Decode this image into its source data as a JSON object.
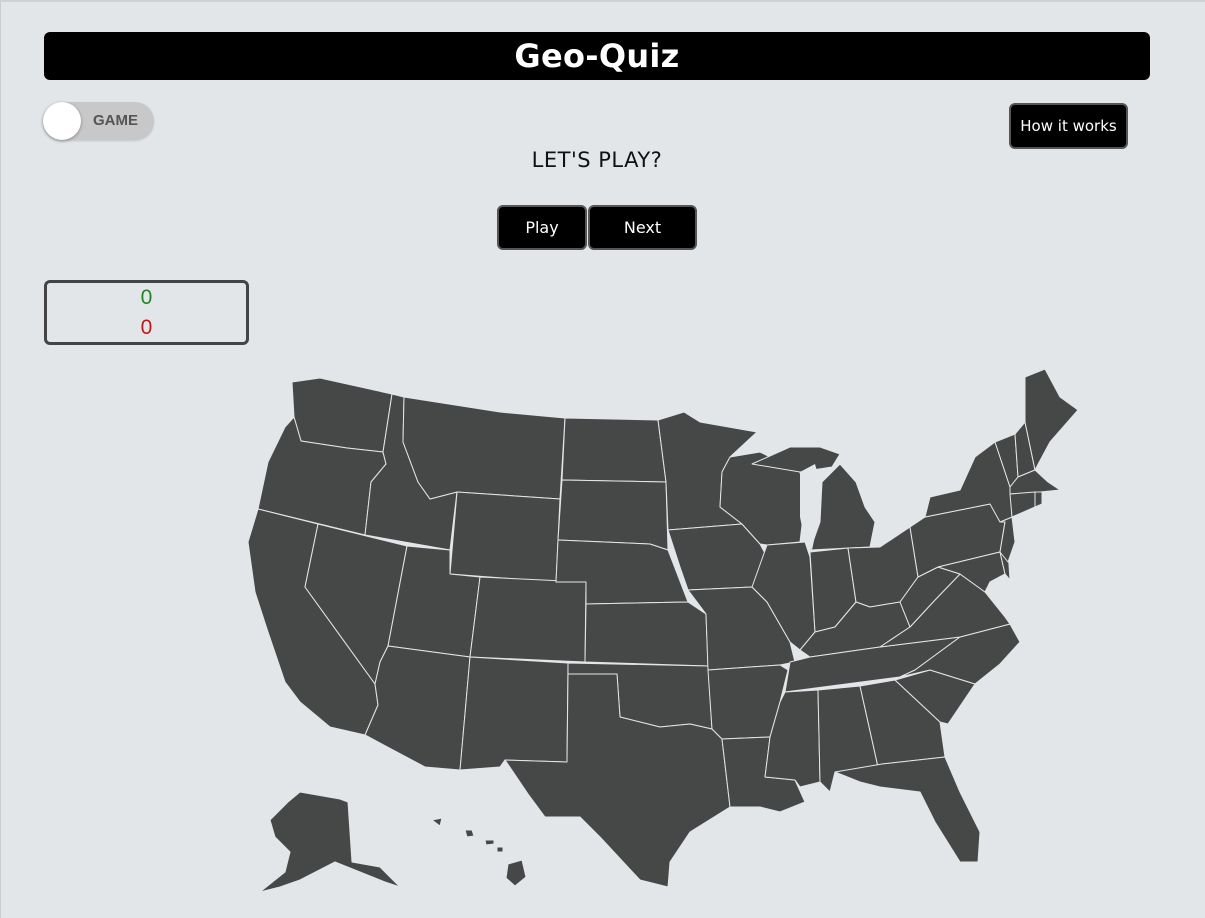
{
  "header": {
    "title": "Geo-Quiz"
  },
  "mode_toggle": {
    "label": "GAME",
    "state": "off"
  },
  "help": {
    "label": "How it works"
  },
  "prompt": {
    "text": "LET'S PLAY?"
  },
  "controls": {
    "play_label": "Play",
    "next_label": "Next"
  },
  "score": {
    "correct": "0",
    "wrong": "0"
  },
  "colors": {
    "background": "#e3e6e9",
    "header_bg": "#000000",
    "state_fill": "#464848",
    "state_border": "#e3e6e9",
    "correct": "#1b8a1b",
    "wrong": "#c81414"
  },
  "map": {
    "name": "United States",
    "icon": "us-states-map"
  }
}
